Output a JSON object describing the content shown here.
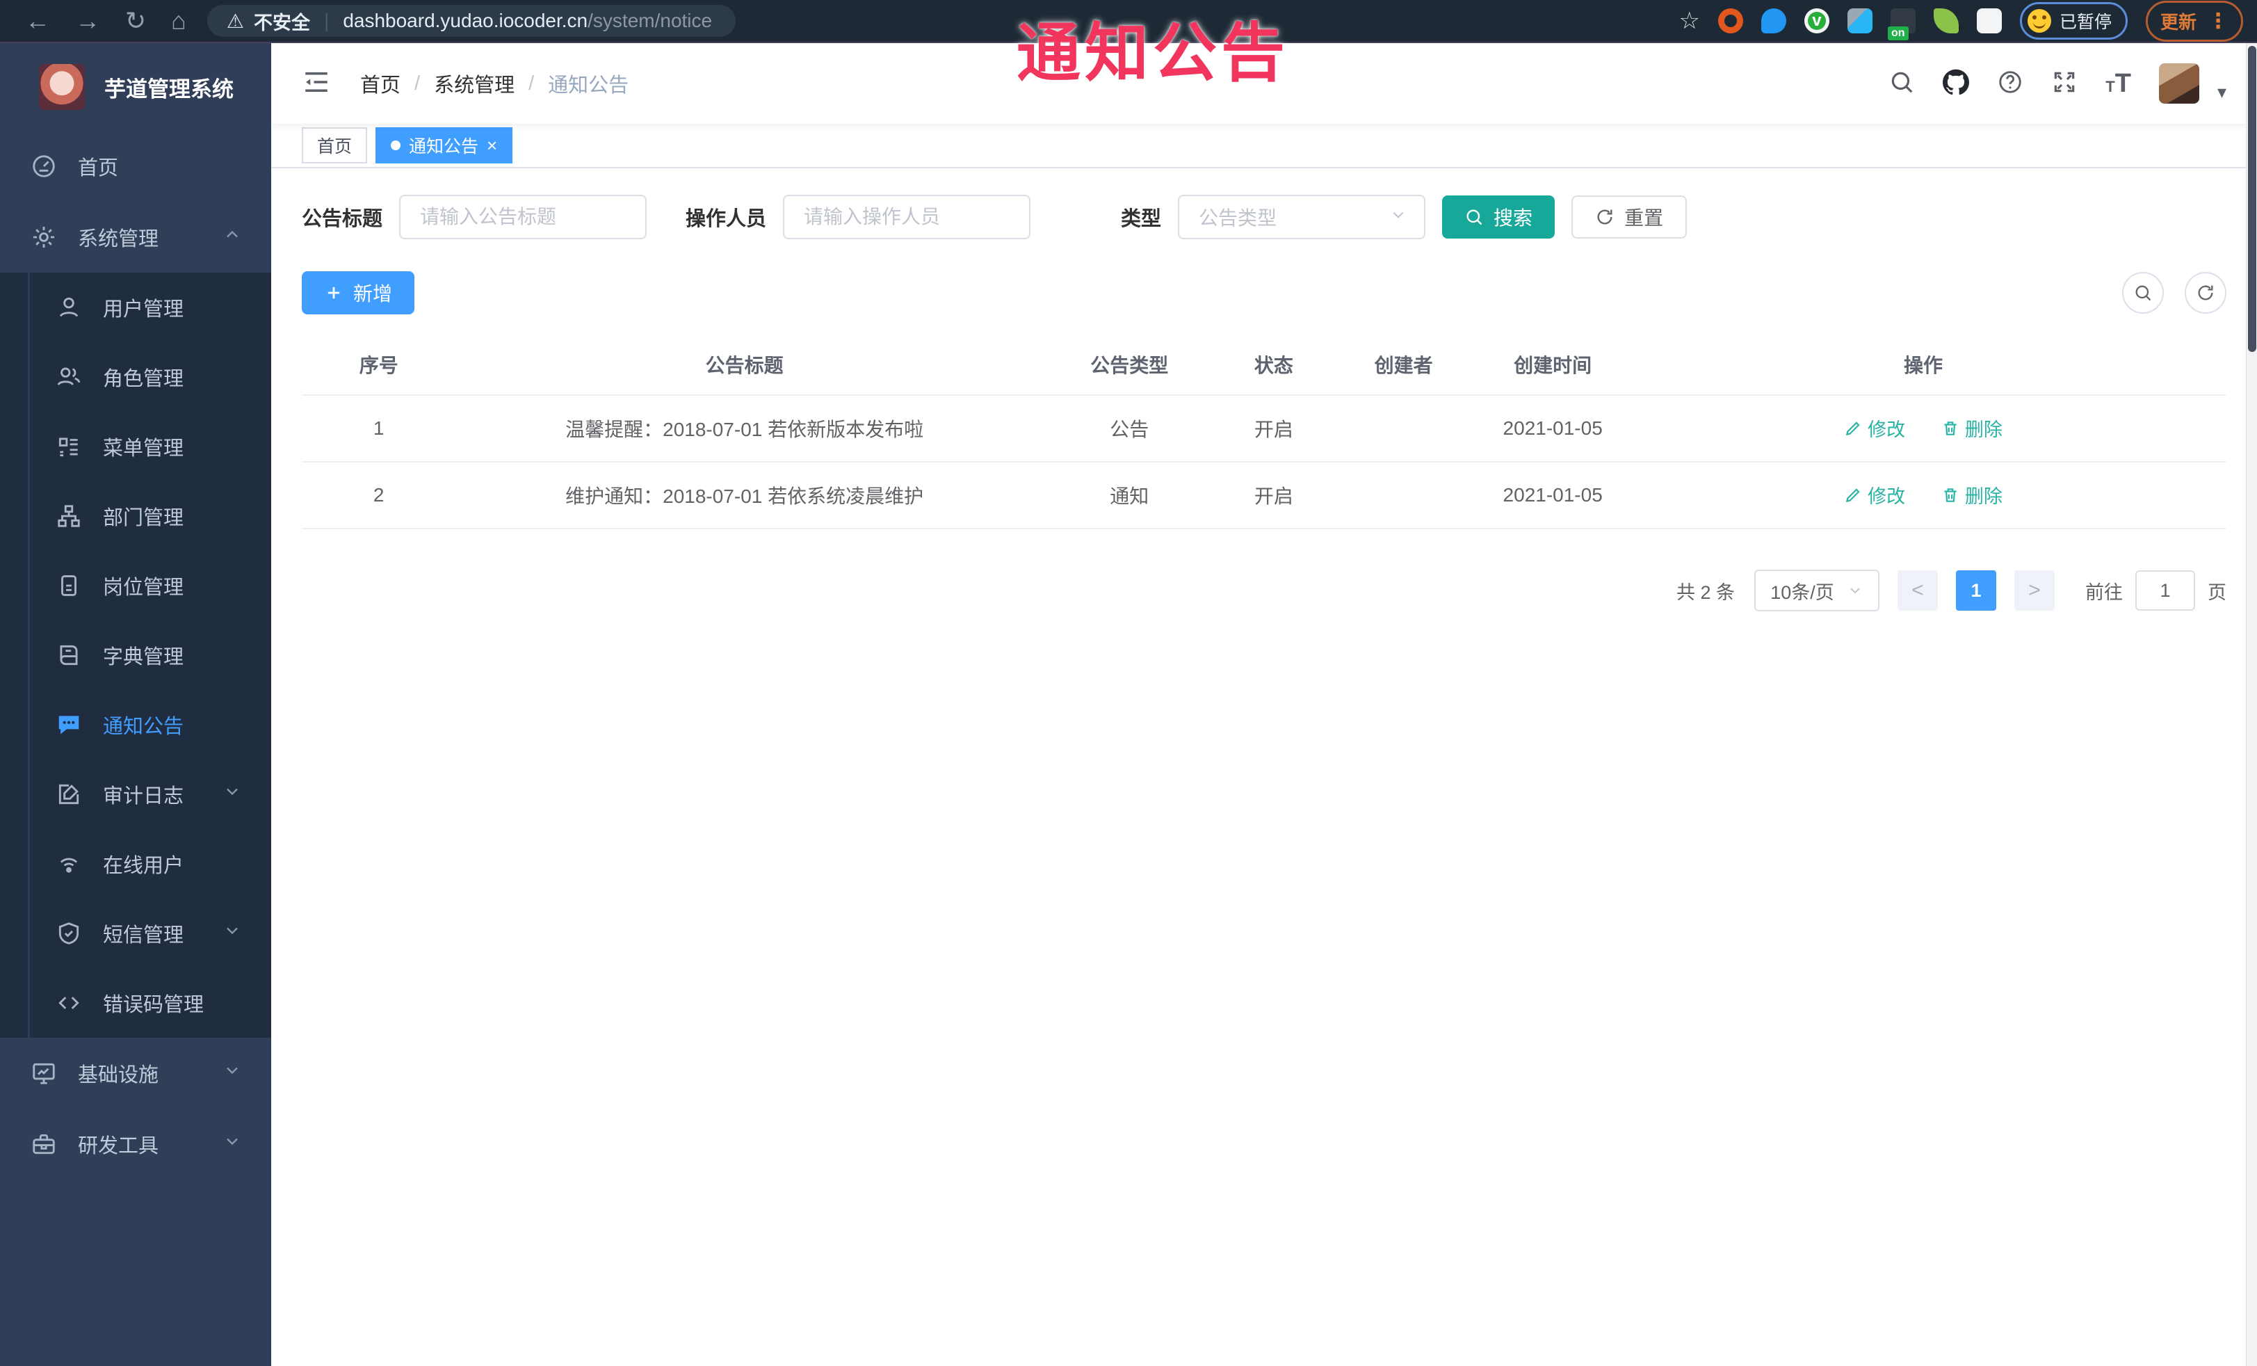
{
  "annotation": {
    "text": "通知公告"
  },
  "browser": {
    "security_label": "不安全",
    "url_host": "dashboard.yudao.iocoder.cn",
    "url_path": "/system/notice",
    "paused_label": "已暂停",
    "update_label": "更新",
    "extension_on_badge": "on"
  },
  "icons": {
    "back": "←",
    "forward": "→",
    "reload": "↻",
    "home": "⌂",
    "warning": "⚠",
    "star": "☆",
    "divider": "|",
    "overflow": "⋮",
    "ext_v": "v",
    "slash": "/",
    "close": "×",
    "caret": "▾",
    "prev": "<",
    "next": ">",
    "font_small": "T",
    "font_big": "T"
  },
  "sidebar": {
    "app_title": "芋道管理系统",
    "items": [
      {
        "label": "首页"
      },
      {
        "label": "系统管理"
      },
      {
        "label": "用户管理"
      },
      {
        "label": "角色管理"
      },
      {
        "label": "菜单管理"
      },
      {
        "label": "部门管理"
      },
      {
        "label": "岗位管理"
      },
      {
        "label": "字典管理"
      },
      {
        "label": "通知公告"
      },
      {
        "label": "审计日志"
      },
      {
        "label": "在线用户"
      },
      {
        "label": "短信管理"
      },
      {
        "label": "错误码管理"
      },
      {
        "label": "基础设施"
      },
      {
        "label": "研发工具"
      }
    ]
  },
  "header": {
    "breadcrumb": {
      "home": "首页",
      "section": "系统管理",
      "current": "通知公告"
    }
  },
  "tabs": {
    "home": "首页",
    "current": "通知公告"
  },
  "filters": {
    "title_label": "公告标题",
    "title_placeholder": "请输入公告标题",
    "operator_label": "操作人员",
    "operator_placeholder": "请输入操作人员",
    "type_label": "类型",
    "type_placeholder": "公告类型",
    "search_label": "搜索",
    "reset_label": "重置"
  },
  "toolbar": {
    "add_label": "新增"
  },
  "table": {
    "columns": [
      "序号",
      "公告标题",
      "公告类型",
      "状态",
      "创建者",
      "创建时间",
      "操作"
    ],
    "rows": [
      {
        "no": "1",
        "title": "温馨提醒：2018-07-01 若依新版本发布啦",
        "type": "公告",
        "status": "开启",
        "creator": "",
        "created": "2021-01-05"
      },
      {
        "no": "2",
        "title": "维护通知：2018-07-01 若依系统凌晨维护",
        "type": "通知",
        "status": "开启",
        "creator": "",
        "created": "2021-01-05"
      }
    ],
    "edit_label": "修改",
    "delete_label": "删除"
  },
  "pagination": {
    "total_label": "共 2 条",
    "page_size_label": "10条/页",
    "current_page": "1",
    "goto_label": "前往",
    "goto_value": "1",
    "page_suffix": "页"
  },
  "colors": {
    "primary": "#409eff",
    "search_button": "#17a89a",
    "action_link": "#28b3a4",
    "sidebar_bg": "#313e58",
    "submenu_bg": "#202c40",
    "annotation": "#f2355c"
  }
}
